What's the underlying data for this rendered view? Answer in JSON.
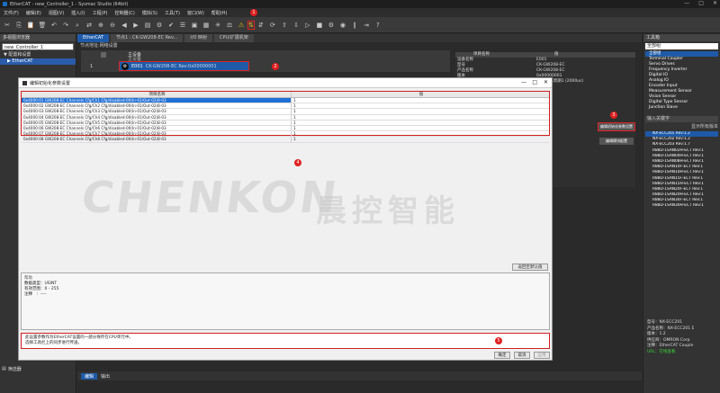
{
  "window": {
    "title": "EtherCAT - new_Controller_1 - Sysmac Studio (64bit)",
    "minimize": "—",
    "maximize": "□",
    "close": "✕"
  },
  "menu": [
    "文件(F)",
    "编辑(E)",
    "视图(V)",
    "插入(I)",
    "工程(P)",
    "控制器(C)",
    "模拟(S)",
    "工具(T)",
    "窗口(W)",
    "帮助(H)"
  ],
  "markers": [
    "1",
    "2",
    "3",
    "4",
    "5"
  ],
  "left_pane": {
    "title": "多视图浏览器",
    "controller": "new_Controller_1",
    "items": [
      "▼ 配置和设置",
      "▶ EtherCAT"
    ]
  },
  "editor_tabs": [
    "EtherCAT",
    "节点1 : CK-GW208-EC Rev...",
    "I/O 映射",
    "CPU/扩展机架"
  ],
  "node_panel": {
    "header": "节点地址:网络设置",
    "master": "主设备",
    "master_sub": "主设备",
    "node_num": "1",
    "device_label": "E001",
    "device_name": "CK-GW208-EC Rev:0x00000001"
  },
  "props": {
    "header_name": "项目名称",
    "header_value": "值",
    "rows": [
      {
        "k": "设备名称",
        "v": "E001"
      },
      {
        "k": "型号",
        "v": "CK-GW208-EC"
      },
      {
        "k": "产品名称",
        "v": "CK-GW208-EC"
      },
      {
        "k": "版本",
        "v": "0x00000001"
      },
      {
        "k": "",
        "v": "PDO通信周期1 (2000us)"
      }
    ],
    "setup_label": "设置",
    "edit_params_btn": "编辑初始化参数设置",
    "setup2": "设置",
    "edit_setup_btn": "编辑模块配置"
  },
  "dialog": {
    "title": "编辑初始化参数设置",
    "col_param": "项目名称",
    "col_value": "值",
    "rows": [
      "0x4000:01 GW208-EC Channels Cfg/Ch1 Cfg/disabled-00(In-01/Out-02)8-03",
      "0x4000:02 GW208-EC Channels Cfg/Ch2 Cfg/disabled-00(In-01/Out-02)8-03",
      "0x4000:03 GW208-EC Channels Cfg/Ch3 Cfg/disabled-00(In-01/Out-02)8-03",
      "0x4000:04 GW208-EC Channels Cfg/Ch4 Cfg/disabled-00(In-01/Out-02)8-03",
      "0x4000:05 GW208-EC Channels Cfg/Ch5 Cfg/disabled-00(In-01/Out-02)8-03",
      "0x4000:06 GW208-EC Channels Cfg/Ch6 Cfg/disabled-00(In-01/Out-02)8-03",
      "0x4000:07 GW208-EC Channels Cfg/Ch7 Cfg/disabled-00(In-01/Out-02)8-03",
      "0x4000:08 GW208-EC Channels Cfg/Ch8 Cfg/disabled-00(In-01/Out-02)8-03"
    ],
    "values": [
      "1",
      "1",
      "1",
      "1",
      "1",
      "1",
      "1",
      "1"
    ],
    "restore_btn": "返回至默认值",
    "help_title": "帮助",
    "help_lines": [
      "数据类型：USINT",
      "有效范围：0 - 255",
      "注释　：----"
    ],
    "info_lines": [
      "此设置参数作为EtherCAT设置的一部分保存在CPU单元中。",
      "选择工具栏上的同步进行传送。"
    ],
    "ok": "确定",
    "cancel": "取消",
    "apply": "应用"
  },
  "watermark": {
    "en": "CHENKON",
    "cn": "晨控智能"
  },
  "right_pane": {
    "title": "工具箱",
    "search": "全部组",
    "categories": [
      "全部组",
      "Terminal Coupler",
      "Servo Drives",
      "Frequency Inverter",
      "Digital IO",
      "Analog IO",
      "Encoder Input",
      "Measurement Sensor",
      "Vision Sensor",
      "Digital Type Sensor",
      "Junction Slave"
    ],
    "vendor": "输入关键字",
    "show_all": "显示所有版本",
    "devices": [
      "NX-ECC201 Rev:1.2",
      "NX-ECC202 Rev:1.2",
      "NX-ECC203 Rev:1.7",
      "R88D-1SAN02H-ECT Rev:1",
      "R88D-1SAN04H-ECT Rev:1",
      "R88D-1SAN08H-ECT Rev:1",
      "R88D-1SAN10F-ECT Rev:1",
      "R88D-1SAN10H-ECT Rev:1",
      "R88D-1SAN15F-ECT Rev:1",
      "R88D-1SAN15H-ECT Rev:1",
      "R88D-1SAN20F-ECT Rev:1",
      "R88D-1SAN20H-ECT Rev:1",
      "R88D-1SAN30F-ECT Rev:1",
      "R88D-1SAN30H-ECT Rev:1"
    ],
    "info": [
      "型号：NX-ECC201",
      "产品名称：NX-ECC201 E",
      "版本：1.2",
      "供应商：OMRON Corp",
      "注释：EtherCAT Couple",
      "URL：在线查看"
    ]
  },
  "bottom": {
    "filter": "筛选器",
    "tab1": "编辑",
    "tab2": "输出"
  }
}
